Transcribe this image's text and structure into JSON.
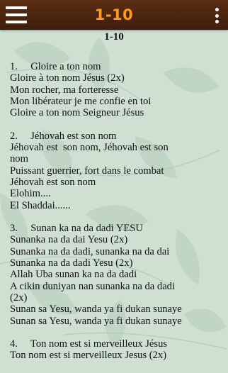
{
  "app": {
    "title": "1-10"
  },
  "page": {
    "heading": "1-10"
  },
  "songs": [
    {
      "title": "1.     Gloire a ton nom",
      "lines": [
        "Gloire à ton nom Jésus (2x)",
        "Mon rocher, ma forteresse",
        "Mon libérateur je me confie en toi",
        "Gloire a ton nom Seigneur Jésus"
      ]
    },
    {
      "title": "2.     Jéhovah est son nom",
      "lines": [
        "Jéhovah est  son nom, Jéhovah est son",
        "nom",
        "Puissant guerrier, fort dans le combat",
        "Jéhovah est son nom",
        "Elohim....",
        "El Shaddai......"
      ]
    },
    {
      "title": "3.     Sunan ka na da dadi YESU",
      "lines": [
        "Sunanka na da dai Yesu (2x)",
        "Sunanka na da dadi, sunanka na da dai",
        "Sunanka na da dadi Yesu (2x)",
        "Allah Uba sunan ka na da dadi",
        "A cikin duniyan nan sunanka na da dadi",
        "(2x)",
        "Sunan sa Yesu, wanda ya fi dukan sunaye",
        "Sunan sa Yesu, wanda ya fi dukan sunaye"
      ]
    },
    {
      "title": "4.     Ton nom est si merveilleux Jésus",
      "lines": [
        "Ton nom est si merveilleux Jesus (2x)"
      ]
    }
  ],
  "icons": {
    "menu": "hamburger-menu-icon",
    "more": "more-vertical-icon"
  },
  "colors": {
    "toolbar": "#4a230f",
    "title": "#ff9a1a",
    "background": "#cfe0d3"
  }
}
